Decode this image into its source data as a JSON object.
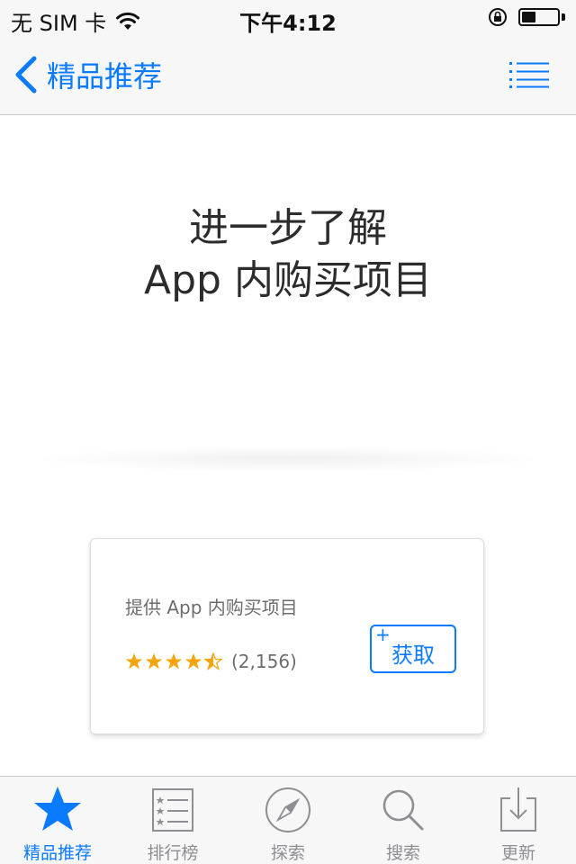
{
  "status_bar": {
    "carrier": "无 SIM 卡",
    "time": "下午4:12",
    "battery_level": 0.45
  },
  "nav": {
    "back_label": "精品推荐",
    "accent_color": "#0a7aff",
    "list_icon": "list-icon"
  },
  "hero": {
    "line1": "进一步了解",
    "line2": "App 内购买项目"
  },
  "card": {
    "iap_note": "提供 App 内购买项目",
    "rating_stars": 4.5,
    "rating_count": "(2,156)",
    "get_plus": "+",
    "get_label": "获取"
  },
  "tab_bar": {
    "tabs": [
      {
        "label": "精品推荐",
        "icon": "star-icon",
        "active": true
      },
      {
        "label": "排行榜",
        "icon": "ranking-list-icon",
        "active": false
      },
      {
        "label": "探索",
        "icon": "compass-icon",
        "active": false
      },
      {
        "label": "搜索",
        "icon": "search-icon",
        "active": false
      },
      {
        "label": "更新",
        "icon": "update-download-icon",
        "active": false
      }
    ]
  }
}
